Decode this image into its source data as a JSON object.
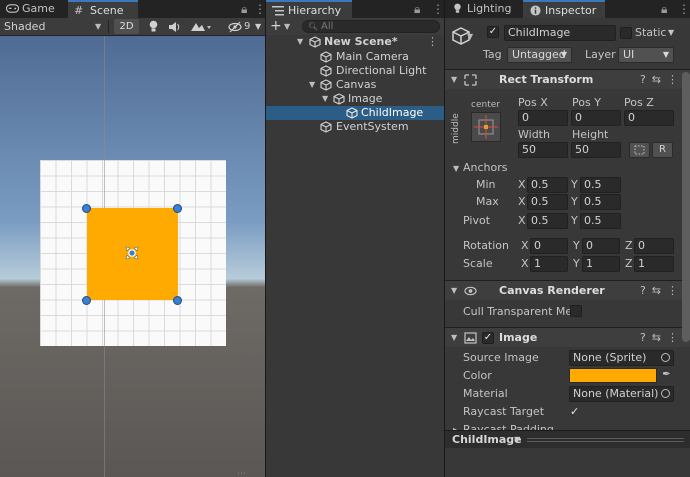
{
  "scene_panel": {
    "tabs": [
      {
        "label": "Game",
        "icon": "gamepad-icon"
      },
      {
        "label": "Scene",
        "icon": "grid-icon"
      }
    ],
    "shading_mode": "Shaded",
    "mode_2d_label": "2D",
    "hidden_count": "9"
  },
  "hierarchy": {
    "tab_label": "Hierarchy",
    "search_placeholder": "All",
    "items": [
      {
        "label": "New Scene*",
        "depth": 0,
        "expanded": true,
        "selected": false,
        "icon": "unity-scene-icon"
      },
      {
        "label": "Main Camera",
        "depth": 1,
        "selected": false,
        "icon": "gameobject-cube-icon"
      },
      {
        "label": "Directional Light",
        "depth": 1,
        "selected": false,
        "icon": "gameobject-cube-icon"
      },
      {
        "label": "Canvas",
        "depth": 1,
        "expanded": true,
        "selected": false,
        "icon": "gameobject-cube-icon"
      },
      {
        "label": "Image",
        "depth": 2,
        "expanded": true,
        "selected": false,
        "icon": "gameobject-cube-icon"
      },
      {
        "label": "ChildImage",
        "depth": 3,
        "selected": true,
        "icon": "gameobject-cube-icon"
      },
      {
        "label": "EventSystem",
        "depth": 1,
        "selected": false,
        "icon": "gameobject-cube-icon"
      }
    ]
  },
  "inspector": {
    "tabs": [
      {
        "label": "Lighting",
        "icon": "lightbulb-icon"
      },
      {
        "label": "Inspector",
        "icon": "info-icon"
      }
    ],
    "object": {
      "active": true,
      "name": "ChildImage",
      "static_label": "Static",
      "tag_label": "Tag",
      "tag_value": "Untagged",
      "layer_label": "Layer",
      "layer_value": "UI"
    },
    "rect_transform": {
      "title": "Rect Transform",
      "anchor_preset_top": "center",
      "anchor_preset_side": "middle",
      "pos_x_label": "Pos X",
      "pos_y_label": "Pos Y",
      "pos_z_label": "Pos Z",
      "pos_x": "0",
      "pos_y": "0",
      "pos_z": "0",
      "width_label": "Width",
      "height_label": "Height",
      "width": "50",
      "height": "50",
      "raw_edit_label": "R",
      "anchors_label": "Anchors",
      "min_label": "Min",
      "max_label": "Max",
      "anchor_min": {
        "x": "0.5",
        "y": "0.5"
      },
      "anchor_max": {
        "x": "0.5",
        "y": "0.5"
      },
      "pivot_label": "Pivot",
      "pivot": {
        "x": "0.5",
        "y": "0.5"
      },
      "rotation_label": "Rotation",
      "rotation": {
        "x": "0",
        "y": "0",
        "z": "0"
      },
      "scale_label": "Scale",
      "scale": {
        "x": "1",
        "y": "1",
        "z": "1"
      },
      "axis_x": "X",
      "axis_y": "Y",
      "axis_z": "Z"
    },
    "canvas_renderer": {
      "title": "Canvas Renderer",
      "cull_label": "Cull Transparent Mes",
      "cull_value": false
    },
    "image": {
      "title": "Image",
      "enabled": true,
      "source_image_label": "Source Image",
      "source_image_value": "None (Sprite)",
      "color_label": "Color",
      "color_value": "#ffaa00",
      "material_label": "Material",
      "material_value": "None (Material)",
      "raycast_target_label": "Raycast Target",
      "raycast_target_value": true,
      "raycast_padding_label": "Raycast Padding"
    },
    "footer_name": "ChildImage"
  }
}
